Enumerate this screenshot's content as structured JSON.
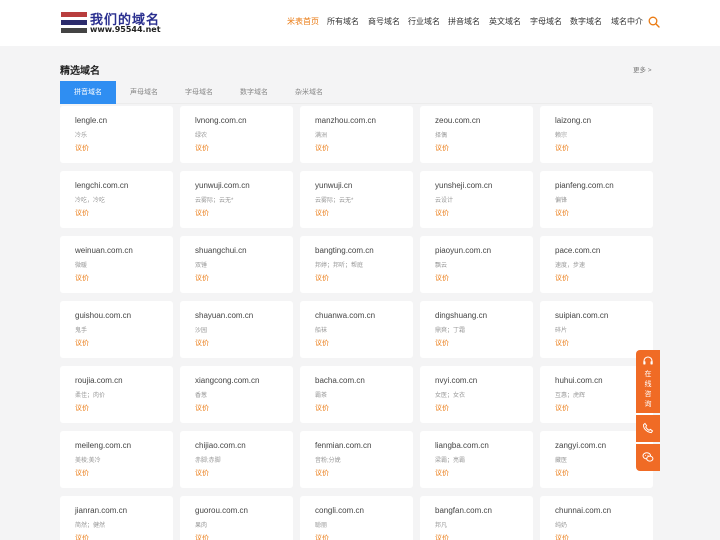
{
  "logo": {
    "main_text": "我们的域名",
    "url_text": "www.95544.net"
  },
  "nav": [
    {
      "label": "米表首页",
      "active": true
    },
    {
      "label": "所有域名",
      "active": false
    },
    {
      "label": "商号域名",
      "active": false
    },
    {
      "label": "行业域名",
      "active": false
    },
    {
      "label": "拼音域名",
      "active": false
    },
    {
      "label": "英文域名",
      "active": false
    },
    {
      "label": "字母域名",
      "active": false
    },
    {
      "label": "数字域名",
      "active": false
    },
    {
      "label": "域名中介",
      "active": false
    }
  ],
  "section": {
    "title": "精选域名",
    "more": "更多 >"
  },
  "tabs": [
    {
      "label": "拼音域名",
      "active": true
    },
    {
      "label": "声母域名",
      "active": false
    },
    {
      "label": "字母域名",
      "active": false
    },
    {
      "label": "数字域名",
      "active": false
    },
    {
      "label": "杂米域名",
      "active": false
    }
  ],
  "domains": [
    {
      "name": "lengle.cn",
      "meaning": "冷乐",
      "price": "议价"
    },
    {
      "name": "lvnong.com.cn",
      "meaning": "绿农",
      "price": "议价"
    },
    {
      "name": "manzhou.com.cn",
      "meaning": "满洲",
      "price": "议价"
    },
    {
      "name": "zeou.com.cn",
      "meaning": "择偶",
      "price": "议价"
    },
    {
      "name": "laizong.cn",
      "meaning": "赖宗",
      "price": "议价"
    },
    {
      "name": "lengchi.com.cn",
      "meaning": "冷吃，冷吃",
      "price": "议价"
    },
    {
      "name": "yunwuji.com.cn",
      "meaning": "云雾际；云无*",
      "price": "议价"
    },
    {
      "name": "yunwuji.cn",
      "meaning": "云雾际；云无*",
      "price": "议价"
    },
    {
      "name": "yunsheji.com.cn",
      "meaning": "云设计",
      "price": "议价"
    },
    {
      "name": "pianfeng.com.cn",
      "meaning": "偏锋",
      "price": "议价"
    },
    {
      "name": "weinuan.com.cn",
      "meaning": "微暖",
      "price": "议价"
    },
    {
      "name": "shuangchui.cn",
      "meaning": "双锤",
      "price": "议价"
    },
    {
      "name": "bangting.com.cn",
      "meaning": "邦婷；邦听；帮庭",
      "price": "议价"
    },
    {
      "name": "piaoyun.com.cn",
      "meaning": "飘云",
      "price": "议价"
    },
    {
      "name": "pace.com.cn",
      "meaning": "速度，步速",
      "price": "议价"
    },
    {
      "name": "guishou.com.cn",
      "meaning": "鬼手",
      "price": "议价"
    },
    {
      "name": "shayuan.com.cn",
      "meaning": "沙园",
      "price": "议价"
    },
    {
      "name": "chuanwa.com.cn",
      "meaning": "船袜",
      "price": "议价"
    },
    {
      "name": "dingshuang.cn",
      "meaning": "鼎爽；丁霜",
      "price": "议价"
    },
    {
      "name": "suipian.com.cn",
      "meaning": "碎片",
      "price": "议价"
    },
    {
      "name": "roujia.com.cn",
      "meaning": "柔佳；肉价",
      "price": "议价"
    },
    {
      "name": "xiangcong.com.cn",
      "meaning": "香葱",
      "price": "议价"
    },
    {
      "name": "bacha.com.cn",
      "meaning": "霸茶",
      "price": "议价"
    },
    {
      "name": "nvyi.com.cn",
      "meaning": "女医；女衣",
      "price": "议价"
    },
    {
      "name": "huhui.com.cn",
      "meaning": "互惠；虎辉",
      "price": "议价"
    },
    {
      "name": "meileng.com.cn",
      "meaning": "美棱;美冷",
      "price": "议价"
    },
    {
      "name": "chijiao.com.cn",
      "meaning": "赤脚;赤脚",
      "price": "议价"
    },
    {
      "name": "fenmian.com.cn",
      "meaning": "音粉;分娩",
      "price": "议价"
    },
    {
      "name": "liangba.com.cn",
      "meaning": "梁霸；亮霸",
      "price": "议价"
    },
    {
      "name": "zangyi.com.cn",
      "meaning": "藏医",
      "price": "议价"
    },
    {
      "name": "jianran.com.cn",
      "meaning": "简然；健然",
      "price": "议价"
    },
    {
      "name": "guorou.com.cn",
      "meaning": "果肉",
      "price": "议价"
    },
    {
      "name": "congli.com.cn",
      "meaning": "聪丽",
      "price": "议价"
    },
    {
      "name": "bangfan.com.cn",
      "meaning": "邦凡",
      "price": "议价"
    },
    {
      "name": "chunnai.com.cn",
      "meaning": "纯奶",
      "price": "议价"
    }
  ],
  "float": {
    "consult_chars": [
      "在",
      "线",
      "咨",
      "询"
    ]
  },
  "colors": {
    "accent": "#ea7a12",
    "tab_active": "#2f8ef2",
    "float_bg": "#f06b25"
  },
  "icons": {
    "search": "search-icon",
    "headset": "headset-icon",
    "phone": "phone-icon",
    "wechat": "wechat-icon"
  }
}
